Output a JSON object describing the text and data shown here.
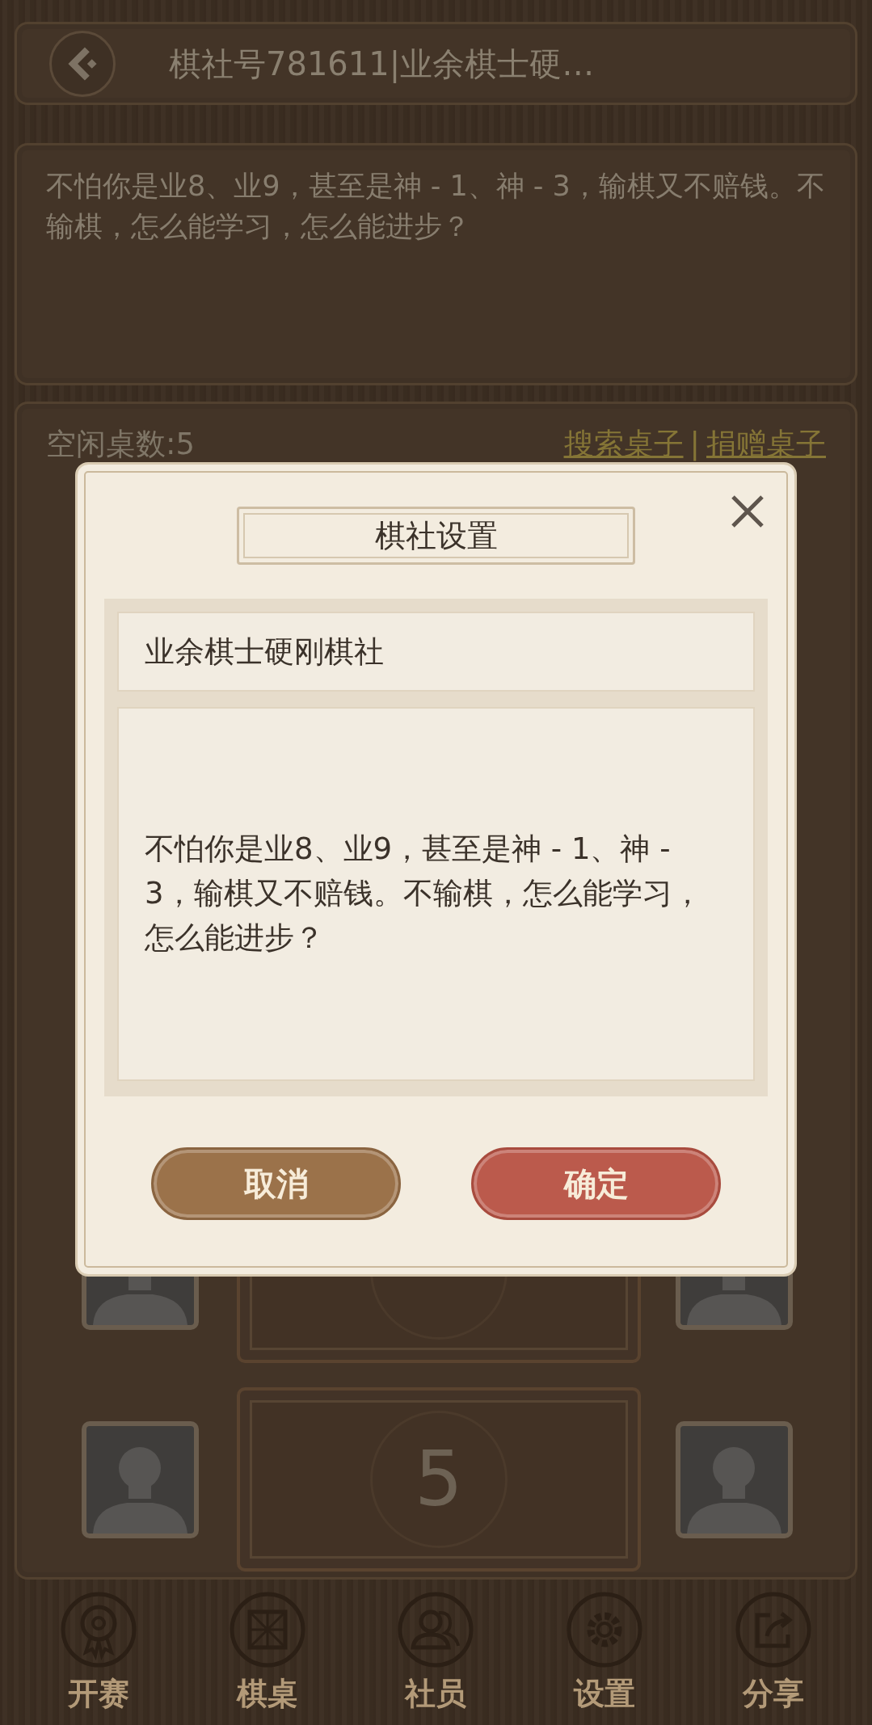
{
  "header": {
    "title": "棋社号781611|业余棋士硬…"
  },
  "club_description": "不怕你是业8、业9，甚至是神 - 1、神 - 3，输棋又不赔钱。不输棋，怎么能学习，怎么能进步？",
  "tables_panel": {
    "free_count": "空闲桌数:5",
    "search_link": "搜索桌子",
    "separator": "|",
    "donate_link": "捐赠桌子"
  },
  "tables": [
    {
      "partly_hidden": true
    },
    {
      "partly_hidden": false,
      "number": "5"
    }
  ],
  "dialog": {
    "title": "棋社设置",
    "name_value": "业余棋士硬刚棋社",
    "description_value": "不怕你是业8、业9，甚至是神 - 1、神 - 3，输棋又不赔钱。不输棋，怎么能学习，怎么能进步？",
    "buttons": [
      {
        "label": "取消",
        "kind": "cancel"
      },
      {
        "label": "确定",
        "kind": "confirm"
      }
    ]
  },
  "bottom_nav": [
    {
      "label": "开赛",
      "kind": "medal"
    },
    {
      "label": "棋桌",
      "kind": "board"
    },
    {
      "label": "社员",
      "kind": "members"
    },
    {
      "label": "设置",
      "kind": "gear"
    },
    {
      "label": "分享",
      "kind": "share"
    }
  ]
}
